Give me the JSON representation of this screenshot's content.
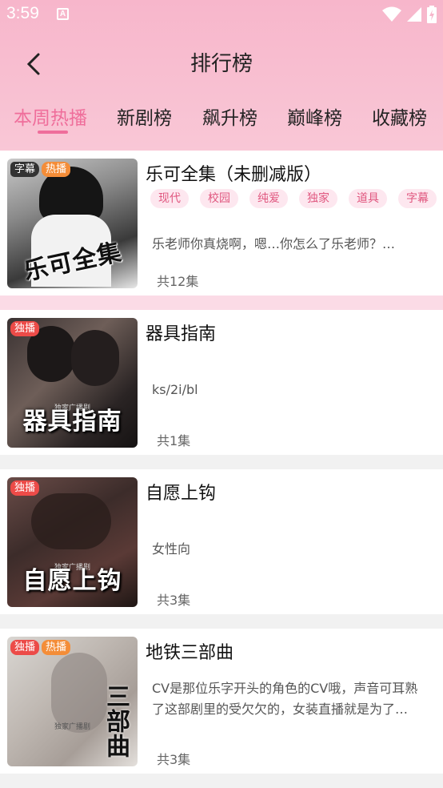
{
  "status_bar": {
    "time": "3:59",
    "app_icon_label": "A"
  },
  "header": {
    "title": "排行榜"
  },
  "tabs": [
    {
      "label": "本周热播",
      "active": true
    },
    {
      "label": "新剧榜",
      "active": false
    },
    {
      "label": "飙升榜",
      "active": false
    },
    {
      "label": "巅峰榜",
      "active": false
    },
    {
      "label": "收藏榜",
      "active": false
    }
  ],
  "items": [
    {
      "title": "乐可全集（未删减版）",
      "cover_text": "乐可全集",
      "cover_sub": "",
      "badges": [
        "字幕",
        "热播"
      ],
      "tags": [
        "现代",
        "校园",
        "纯爱",
        "独家",
        "道具",
        "字幕"
      ],
      "desc": "乐老师你真烧啊，嗯…你怎么了乐老师？…",
      "desc_line2": "",
      "count": "共12集"
    },
    {
      "title": "器具指南",
      "cover_text": "器具指南",
      "cover_sub": "独家广播剧",
      "badges": [
        "独播"
      ],
      "tags": [],
      "desc": "ks/2i/bl",
      "desc_line2": "",
      "count": "共1集"
    },
    {
      "title": "自愿上钩",
      "cover_text": "自愿上钩",
      "cover_sub": "独家广播剧",
      "badges": [
        "独播"
      ],
      "tags": [],
      "desc": "女性向",
      "desc_line2": "",
      "count": "共3集"
    },
    {
      "title": "地铁三部曲",
      "cover_text": "三部曲",
      "cover_sub": "独家广播剧",
      "badges": [
        "独播",
        "热播"
      ],
      "tags": [],
      "desc": "CV是那位乐字开头的角色的CV哦，声音可耳熟",
      "desc_line2": "了这部剧里的受欠欠的，女装直播就是为了…",
      "count": "共3集"
    }
  ],
  "colors": {
    "accent": "#ef6e9b",
    "header_bg": "#f7b6cb",
    "hot_badge": "#f48d38",
    "excl_badge": "#ec4b48"
  }
}
